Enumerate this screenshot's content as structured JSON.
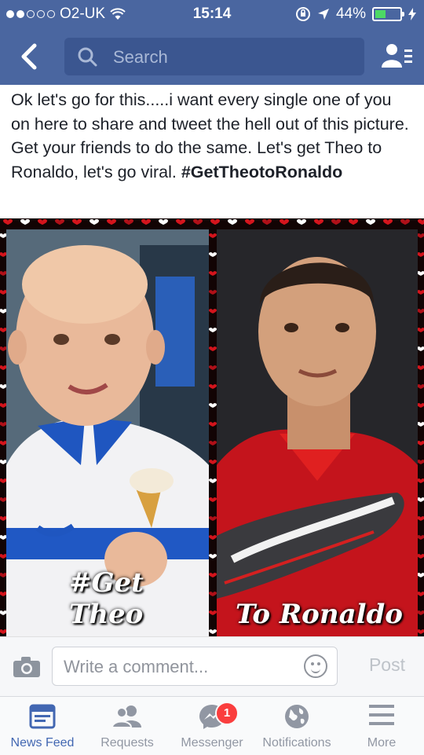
{
  "status_bar": {
    "carrier": "O2-UK",
    "time": "15:14",
    "battery_pct": "44%",
    "signal_bars": 2,
    "battery_level": 0.44
  },
  "nav": {
    "search_placeholder": "Search"
  },
  "post": {
    "text": "Ok let's go for this.....i want every single one of you on here to share and tweet the hell out of this picture.  Get your friends to do the same. Let's get Theo to Ronaldo, let's go viral. ",
    "hashtag": "#GetTheotoRonaldo",
    "image": {
      "caption_left": "#Get Theo",
      "caption_right": "To Ronaldo"
    }
  },
  "comment_bar": {
    "placeholder": "Write a comment...",
    "post_label": "Post"
  },
  "tabs": [
    {
      "label": "News Feed",
      "active": true,
      "icon": "news-feed-icon"
    },
    {
      "label": "Requests",
      "active": false,
      "icon": "friend-requests-icon"
    },
    {
      "label": "Messenger",
      "active": false,
      "icon": "messenger-icon",
      "badge": "1"
    },
    {
      "label": "Notifications",
      "active": false,
      "icon": "globe-icon"
    },
    {
      "label": "More",
      "active": false,
      "icon": "menu-icon"
    }
  ],
  "colors": {
    "brand_blue": "#4a66a0",
    "active_tab": "#4267b2",
    "badge_red": "#fa3e3e",
    "battery_green": "#4cd964"
  }
}
